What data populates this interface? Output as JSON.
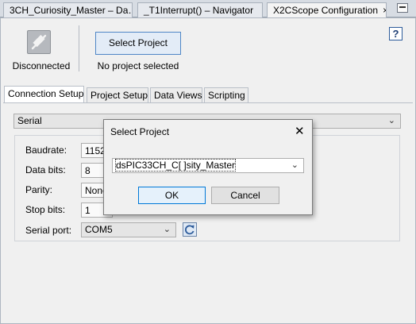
{
  "editor_tabs": [
    {
      "label": "3CH_Curiosity_Master – Da…"
    },
    {
      "label": "_T1Interrupt() – Navigator"
    },
    {
      "label": "X2CScope Configuration",
      "close": "×"
    }
  ],
  "window": {
    "minimize_icon": "minimize-icon"
  },
  "connection": {
    "status": "Disconnected",
    "icon": "plug-disconnected-icon"
  },
  "project": {
    "button_label": "Select Project",
    "status": "No project selected"
  },
  "help": {
    "label": "?"
  },
  "tabs": [
    "Connection Setup",
    "Project Setup",
    "Data Views",
    "Scripting"
  ],
  "connection_setup": {
    "interface": "Serial",
    "fields": [
      {
        "label": "Baudrate:",
        "value": "1152"
      },
      {
        "label": "Data bits:",
        "value": "8"
      },
      {
        "label": "Parity:",
        "value": "None"
      },
      {
        "label": "Stop bits:",
        "value": "1"
      },
      {
        "label": "Serial port:",
        "value": "COM5"
      }
    ],
    "refresh_icon": "refresh-icon"
  },
  "dialog": {
    "title": "Select Project",
    "close": "✕",
    "selected_project": "dsPIC33CH_C[ ]sity_Master",
    "ok_label": "OK",
    "cancel_label": "Cancel"
  },
  "colors": {
    "accent": "#4f86c6",
    "default_button": "#0078d7"
  }
}
